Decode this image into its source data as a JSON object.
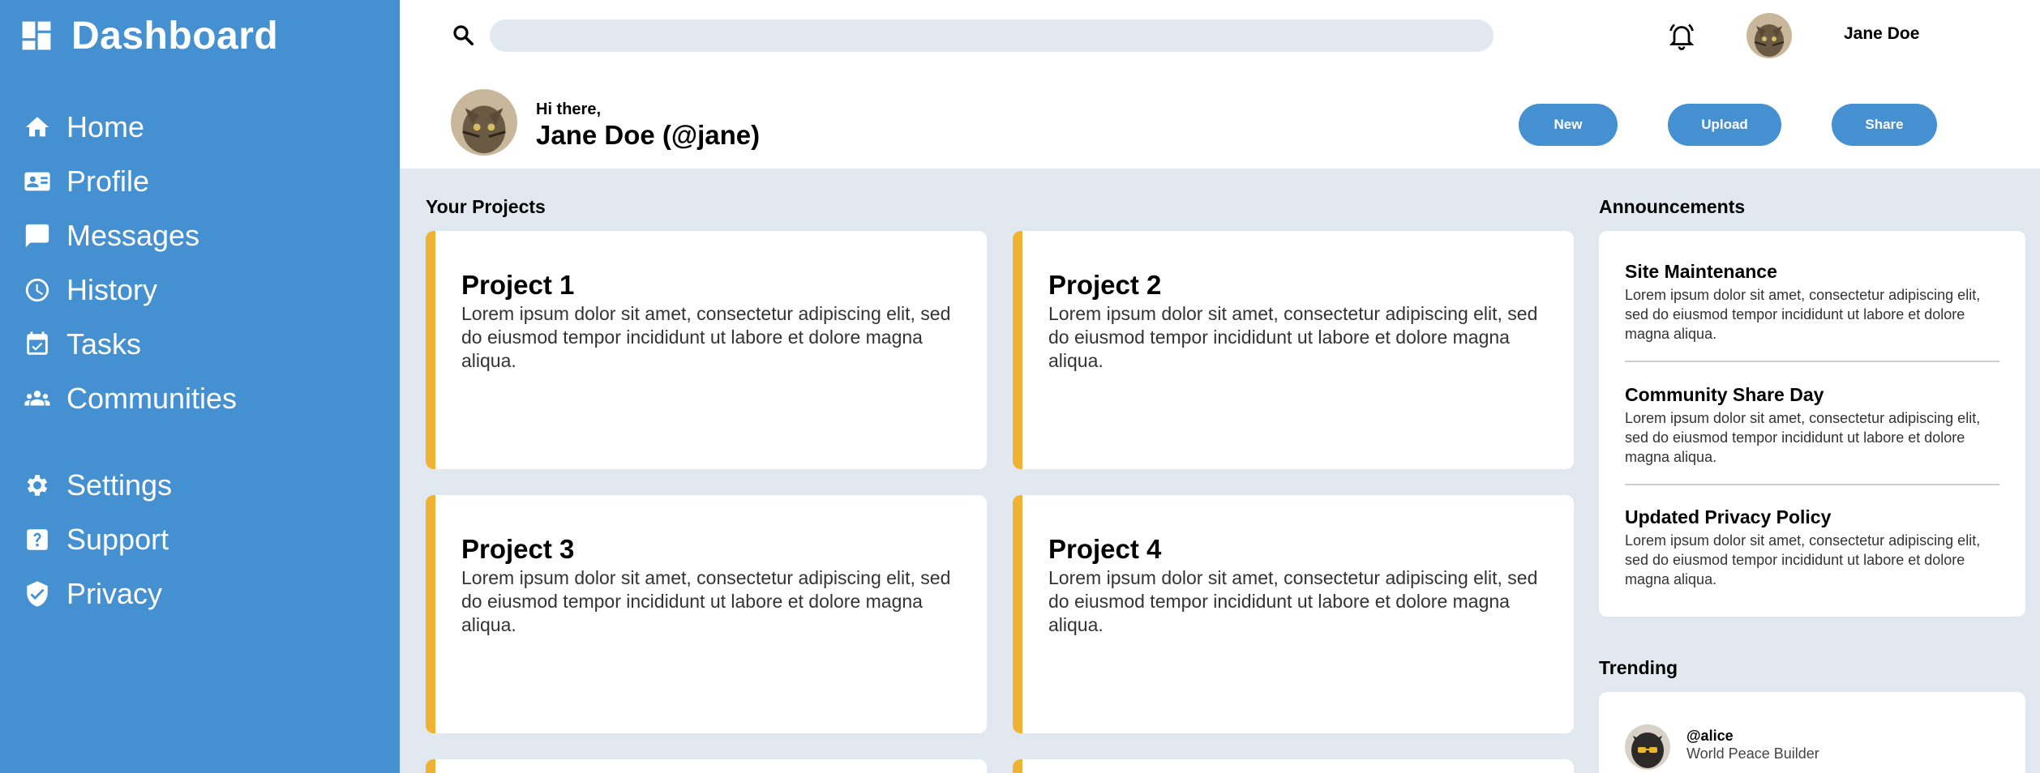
{
  "sidebar": {
    "title": "Dashboard",
    "items": [
      {
        "label": "Home",
        "icon": "home-icon"
      },
      {
        "label": "Profile",
        "icon": "profile-card-icon"
      },
      {
        "label": "Messages",
        "icon": "message-icon"
      },
      {
        "label": "History",
        "icon": "clock-icon"
      },
      {
        "label": "Tasks",
        "icon": "calendar-check-icon"
      },
      {
        "label": "Communities",
        "icon": "people-icon"
      },
      {
        "label": "Settings",
        "icon": "gear-icon"
      },
      {
        "label": "Support",
        "icon": "help-icon"
      },
      {
        "label": "Privacy",
        "icon": "shield-icon"
      }
    ]
  },
  "header": {
    "search_placeholder": "",
    "username": "Jane Doe",
    "greeting": "Hi there,",
    "display_name": "Jane Doe (@jane)",
    "buttons": {
      "new": "New",
      "upload": "Upload",
      "share": "Share"
    }
  },
  "projects": {
    "heading": "Your Projects",
    "items": [
      {
        "title": "Project 1",
        "text": "Lorem ipsum dolor sit amet, consectetur adipiscing elit, sed do eiusmod tempor incididunt ut labore et dolore magna aliqua."
      },
      {
        "title": "Project 2",
        "text": "Lorem ipsum dolor sit amet, consectetur adipiscing elit, sed do eiusmod tempor incididunt ut labore et dolore magna aliqua."
      },
      {
        "title": "Project 3",
        "text": "Lorem ipsum dolor sit amet, consectetur adipiscing elit, sed do eiusmod tempor incididunt ut labore et dolore magna aliqua."
      },
      {
        "title": "Project 4",
        "text": "Lorem ipsum dolor sit amet, consectetur adipiscing elit, sed do eiusmod tempor incididunt ut labore et dolore magna aliqua."
      }
    ]
  },
  "announcements": {
    "heading": "Announcements",
    "items": [
      {
        "title": "Site Maintenance",
        "text": "Lorem ipsum dolor sit amet, consectetur adipiscing elit, sed do eiusmod tempor incididunt ut labore et dolore magna aliqua."
      },
      {
        "title": "Community Share Day",
        "text": "Lorem ipsum dolor sit amet, consectetur adipiscing elit, sed do eiusmod tempor incididunt ut labore et dolore magna aliqua."
      },
      {
        "title": "Updated Privacy Policy",
        "text": "Lorem ipsum dolor sit amet, consectetur adipiscing elit, sed do eiusmod tempor incididunt ut labore et dolore magna aliqua."
      }
    ]
  },
  "trending": {
    "heading": "Trending",
    "items": [
      {
        "handle": "@alice",
        "description": "World Peace Builder"
      }
    ]
  },
  "colors": {
    "sidebar": "#4590d0",
    "accent": "#f0b232",
    "background": "#e2e8f0"
  }
}
